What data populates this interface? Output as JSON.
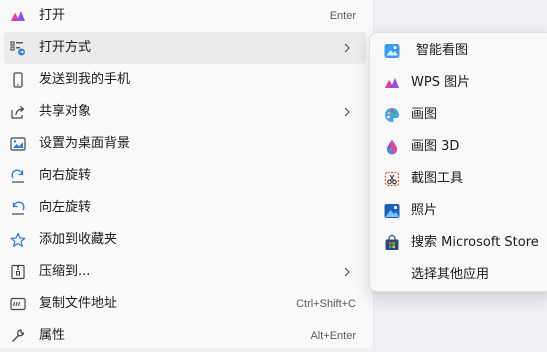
{
  "context_menu": {
    "items": [
      {
        "label": "打开",
        "shortcut": "Enter",
        "icon": "photos-app-icon"
      },
      {
        "label": "打开方式",
        "has_submenu": true,
        "icon": "open-with-icon"
      },
      {
        "label": "发送到我的手机",
        "icon": "phone-icon"
      },
      {
        "label": "共享对象",
        "has_submenu": true,
        "icon": "share-icon"
      },
      {
        "label": "设置为桌面背景",
        "icon": "desktop-background-icon"
      },
      {
        "label": "向右旋转",
        "icon": "rotate-right-icon"
      },
      {
        "label": "向左旋转",
        "icon": "rotate-left-icon"
      },
      {
        "label": "添加到收藏夹",
        "icon": "star-icon"
      },
      {
        "label": "压缩到...",
        "has_submenu": true,
        "icon": "zip-folder-icon"
      },
      {
        "label": "复制文件地址",
        "shortcut": "Ctrl+Shift+C",
        "icon": "copy-path-icon"
      },
      {
        "label": "属性",
        "shortcut": "Alt+Enter",
        "icon": "wrench-icon"
      }
    ]
  },
  "open_with_submenu": {
    "items": [
      {
        "label": "智能看图",
        "icon": "smart-viewer-icon"
      },
      {
        "label": "WPS 图片",
        "icon": "wps-photos-icon"
      },
      {
        "label": "画图",
        "icon": "paint-icon"
      },
      {
        "label": "画图 3D",
        "icon": "paint-3d-icon"
      },
      {
        "label": "截图工具",
        "icon": "snipping-tool-icon"
      },
      {
        "label": "照片",
        "icon": "photos-icon"
      },
      {
        "label": "搜索 Microsoft Store",
        "icon": "microsoft-store-icon"
      },
      {
        "label": "选择其他应用",
        "icon": ""
      }
    ]
  },
  "colors": {
    "menu_background": "#f9f9f9",
    "hover_background": "#ebebeb",
    "accent_purple": "#7a4fe0",
    "accent_blue": "#2a7ad7"
  }
}
